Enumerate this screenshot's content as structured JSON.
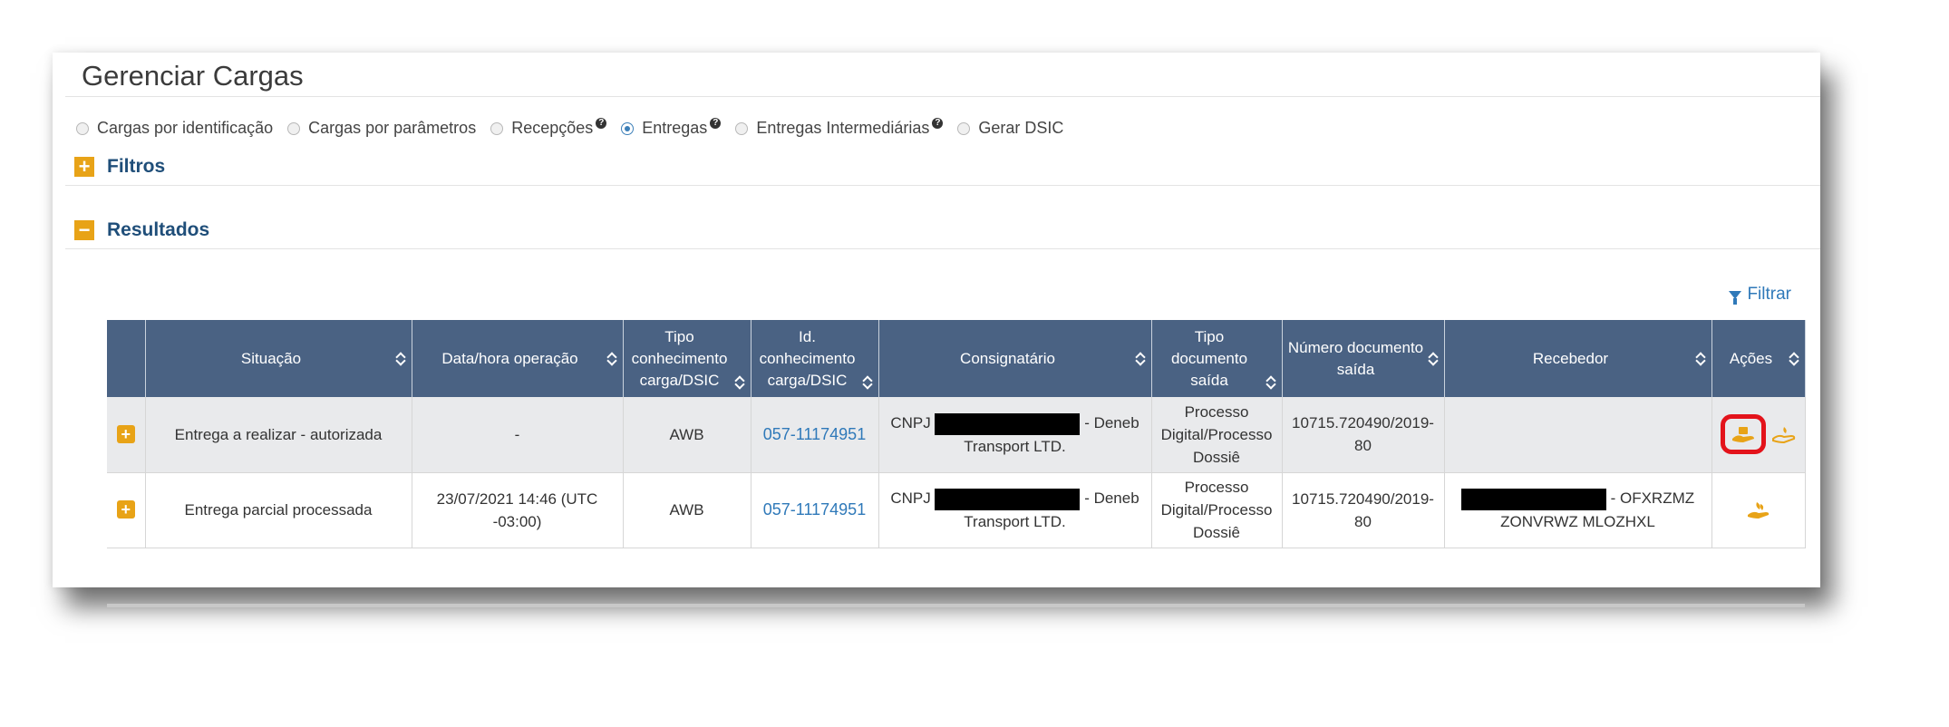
{
  "page": {
    "title": "Gerenciar Cargas"
  },
  "radios": [
    {
      "label": "Cargas por identificação",
      "checked": false,
      "help": false
    },
    {
      "label": "Cargas por parâmetros",
      "checked": false,
      "help": false
    },
    {
      "label": "Recepções",
      "checked": false,
      "help": true
    },
    {
      "label": "Entregas",
      "checked": true,
      "help": true
    },
    {
      "label": "Entregas Intermediárias",
      "checked": false,
      "help": true
    },
    {
      "label": "Gerar DSIC",
      "checked": false,
      "help": false
    }
  ],
  "sections": {
    "filtros": {
      "label": "Filtros",
      "toggle": "+"
    },
    "resultados": {
      "label": "Resultados",
      "toggle": "−"
    }
  },
  "filter_link": "Filtrar",
  "table": {
    "headers": {
      "situacao": "Situação",
      "data_hora": "Data/hora operação",
      "tipo_conhecimento": "Tipo conhecimento carga/DSIC",
      "id_conhecimento": "Id. conhecimento carga/DSIC",
      "consignatario": "Consignatário",
      "tipo_documento": "Tipo documento saída",
      "numero_documento": "Número documento saída",
      "recebedor": "Recebedor",
      "acoes": "Ações"
    },
    "rows": [
      {
        "expand": "+",
        "situacao": "Entrega a realizar - autorizada",
        "data_hora": "-",
        "tipo": "AWB",
        "id": "057-11174951",
        "cnpj_prefix": "CNPJ",
        "consig_suffix": "- Deneb",
        "consig_line2": "Transport LTD.",
        "tipo_doc": "Processo Digital/Processo Dossiê",
        "num_doc": "10715.720490/2019-80",
        "recebedor_suffix": "",
        "recebedor_line2": ""
      },
      {
        "expand": "+",
        "situacao": "Entrega parcial processada",
        "data_hora": "23/07/2021 14:46 (UTC -03:00)",
        "tipo": "AWB",
        "id": "057-11174951",
        "cnpj_prefix": "CNPJ",
        "consig_suffix": "- Deneb",
        "consig_line2": "Transport LTD.",
        "tipo_doc": "Processo Digital/Processo Dossiê",
        "num_doc": "10715.720490/2019-80",
        "recebedor_suffix": "- OFXRZMZ",
        "recebedor_line2": "ZONVRWZ MLOZHXL"
      }
    ]
  },
  "colors": {
    "header_bg": "#4a6283",
    "accent_orange": "#e8a317",
    "link_blue": "#2f79b9",
    "section_label": "#1f4e79",
    "highlight_red": "#e3131b"
  },
  "icons": {
    "deliver_action": "hand-package-icon",
    "partial_action": "hand-plant-icon"
  }
}
